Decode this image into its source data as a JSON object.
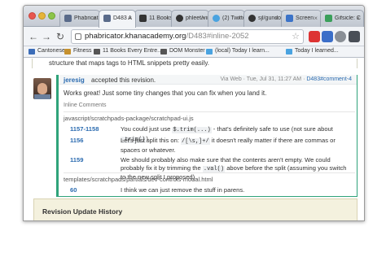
{
  "browser": {
    "tabs": [
      {
        "label": "Phabricator",
        "color": "#5a6b8a"
      },
      {
        "label": "D483 A",
        "color": "#5a6b8a"
      },
      {
        "label": "11 Books Every",
        "color": "#333333"
      },
      {
        "label": "phleet/vir",
        "color": "#333333"
      },
      {
        "label": "(2) Twitter",
        "color": "#4aa3e0"
      },
      {
        "label": "sjl/gundo",
        "color": "#333333"
      },
      {
        "label": "Screen",
        "color": "#3b73c8"
      },
      {
        "label": "Gifsicle: C",
        "color": "#3a9f5a"
      }
    ],
    "url_host": "phabricator.khanacademy.org",
    "url_path": "/D483#inline-2052",
    "bookmarks": [
      {
        "label": "Cantonese",
        "color": "#3c6db8"
      },
      {
        "label": "Fitness",
        "color": "#c6912e"
      },
      {
        "label": "11 Books Every Entre...",
        "color": "#555555"
      },
      {
        "label": "DOM Monster",
        "color": "#555555"
      },
      {
        "label": "(local) Today I learn...",
        "color": "#4aa3e0"
      },
      {
        "label": "Today I learned...",
        "color": "#4aa3e0"
      }
    ]
  },
  "page": {
    "prev_text": "structure that maps tags to HTML snippets pretty easily.",
    "author": "jeresig",
    "action": "accepted this revision.",
    "via": "Via Web · Tue, Jul 31, 11:27 AM · ",
    "anchor": "D483#comment-4",
    "message": "Works great! Just some tiny changes that you can fix when you land it.",
    "inline_label": "Inline Comments",
    "file1": "javascript/scratchpads-package/scratchpad-ui.js",
    "comments": [
      {
        "line": "1157-1158",
        "parts": [
          "You could just use ",
          "$.trim(...)",
          " - that's definitely safe to use (not sure about ",
          ".trim()",
          ")."
        ]
      },
      {
        "line": "1156",
        "parts": [
          "Let's just split this on: ",
          "/[\\s,]+/",
          " it doesn't really matter if there are commas or spaces or whatever."
        ]
      },
      {
        "line": "1159",
        "parts": [
          "We should probably also make sure that the contents aren't empty. We could probably fix it by trimming the ",
          ".val()",
          " above before the split (assuming you switch to the new split I proposed)."
        ]
      }
    ],
    "file2": "templates/scratchpads/partials/dev-controls-modal.html",
    "comment2": {
      "line": "60",
      "text": "I think we can just remove the stuff in parens."
    },
    "revision_title": "Revision Update History"
  }
}
